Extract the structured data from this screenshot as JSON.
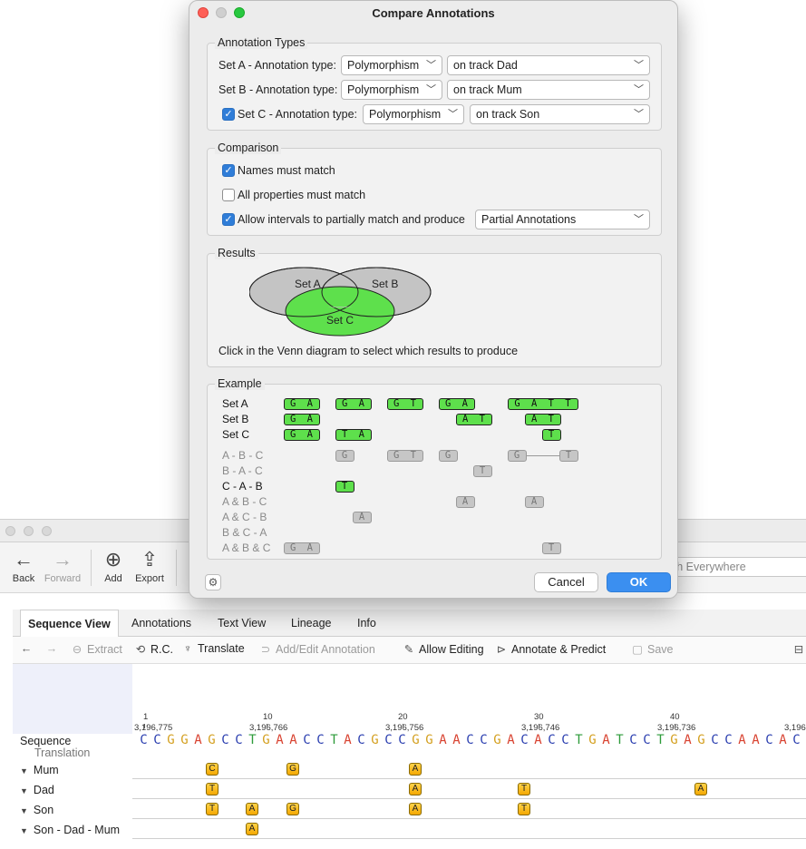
{
  "dialog": {
    "title": "Compare Annotations",
    "annotation_types": {
      "legend": "Annotation Types",
      "set_a_label": "Set A - Annotation type:",
      "set_a_type": "Polymorphism",
      "set_a_track": "on track Dad",
      "set_b_label": "Set B - Annotation type:",
      "set_b_type": "Polymorphism",
      "set_b_track": "on track Mum",
      "set_c_label": "Set C - Annotation type:",
      "set_c_checked": true,
      "set_c_type": "Polymorphism",
      "set_c_track": "on track Son"
    },
    "comparison": {
      "legend": "Comparison",
      "names_must_match": "Names must match",
      "names_checked": true,
      "all_properties": "All properties must match",
      "all_properties_checked": false,
      "allow_intervals": "Allow intervals to partially match and produce",
      "allow_intervals_checked": true,
      "produce_option": "Partial Annotations"
    },
    "results": {
      "legend": "Results",
      "venn_a": "Set A",
      "venn_b": "Set B",
      "venn_c": "Set C",
      "venn_selected": "Set C",
      "hint": "Click in the Venn diagram to select which results to produce"
    },
    "example": {
      "legend": "Example",
      "rows": [
        {
          "label": "Set A",
          "bold": true
        },
        {
          "label": "Set B",
          "bold": true
        },
        {
          "label": "Set C",
          "bold": true
        },
        {
          "label": "A - B - C",
          "bold": false
        },
        {
          "label": "B - A - C",
          "bold": false
        },
        {
          "label": "C - A - B",
          "bold": true
        },
        {
          "label": "A & B - C",
          "bold": false
        },
        {
          "label": "A & C - B",
          "bold": false
        },
        {
          "label": "B & C - A",
          "bold": false
        },
        {
          "label": "A & B & C",
          "bold": false
        }
      ],
      "boxes": {
        "setA": [
          "G A",
          "G A",
          "G T",
          "G A",
          "G A T T"
        ],
        "setB": [
          "G A",
          "A T",
          "A T"
        ],
        "setC": [
          "G A",
          "T A",
          "T"
        ],
        "a_b_c": [
          "G",
          "G T",
          "G",
          "G",
          "T"
        ],
        "b_a_c": [
          "T"
        ],
        "c_a_b": [
          "T"
        ],
        "ab_c": [
          "A",
          "A"
        ],
        "ac_b": [
          "A"
        ],
        "abc": [
          "G A",
          "T"
        ]
      }
    },
    "buttons": {
      "cancel": "Cancel",
      "ok": "OK"
    }
  },
  "main_window": {
    "toolbar": {
      "back": "Back",
      "forward": "Forward",
      "add": "Add",
      "export": "Export",
      "search_placeholder": "Search Everywhere",
      "search_visible": "ch Everywhere"
    },
    "tabs": [
      "Sequence View",
      "Annotations",
      "Text View",
      "Lineage",
      "Info"
    ],
    "active_tab": "Sequence View",
    "seq_toolbar": {
      "extract": "Extract",
      "rc": "R.C.",
      "translate": "Translate",
      "add_edit": "Add/Edit Annotation",
      "allow_editing": "Allow Editing",
      "annotate_predict": "Annotate & Predict",
      "save": "Save"
    },
    "ruler": {
      "positions": [
        "1",
        "10",
        "20",
        "30",
        "40"
      ],
      "coords": [
        "3,196,775",
        "3,196,766",
        "3,196,756",
        "3,196,746",
        "3,196,736",
        "3,196,"
      ]
    },
    "sequence": "CCGGAGCCTGAACCTACGCCGGAACCGACACCTGATCCTGAGCCAACAC",
    "tracks": {
      "sequence": "Sequence",
      "translation": "Translation",
      "mum": "Mum",
      "dad": "Dad",
      "son": "Son",
      "son_dad_mum": "Son - Dad - Mum"
    },
    "snps": {
      "mum": [
        "C",
        "G",
        "A"
      ],
      "dad": [
        "T",
        "A",
        "T",
        "A"
      ],
      "son": [
        "T",
        "A",
        "G",
        "A",
        "T"
      ],
      "son_dad_mum": [
        "A"
      ]
    },
    "colors": {
      "A": "#d8412f",
      "C": "#2b3fb0",
      "G": "#d4a020",
      "T": "#2e9b3a"
    }
  }
}
